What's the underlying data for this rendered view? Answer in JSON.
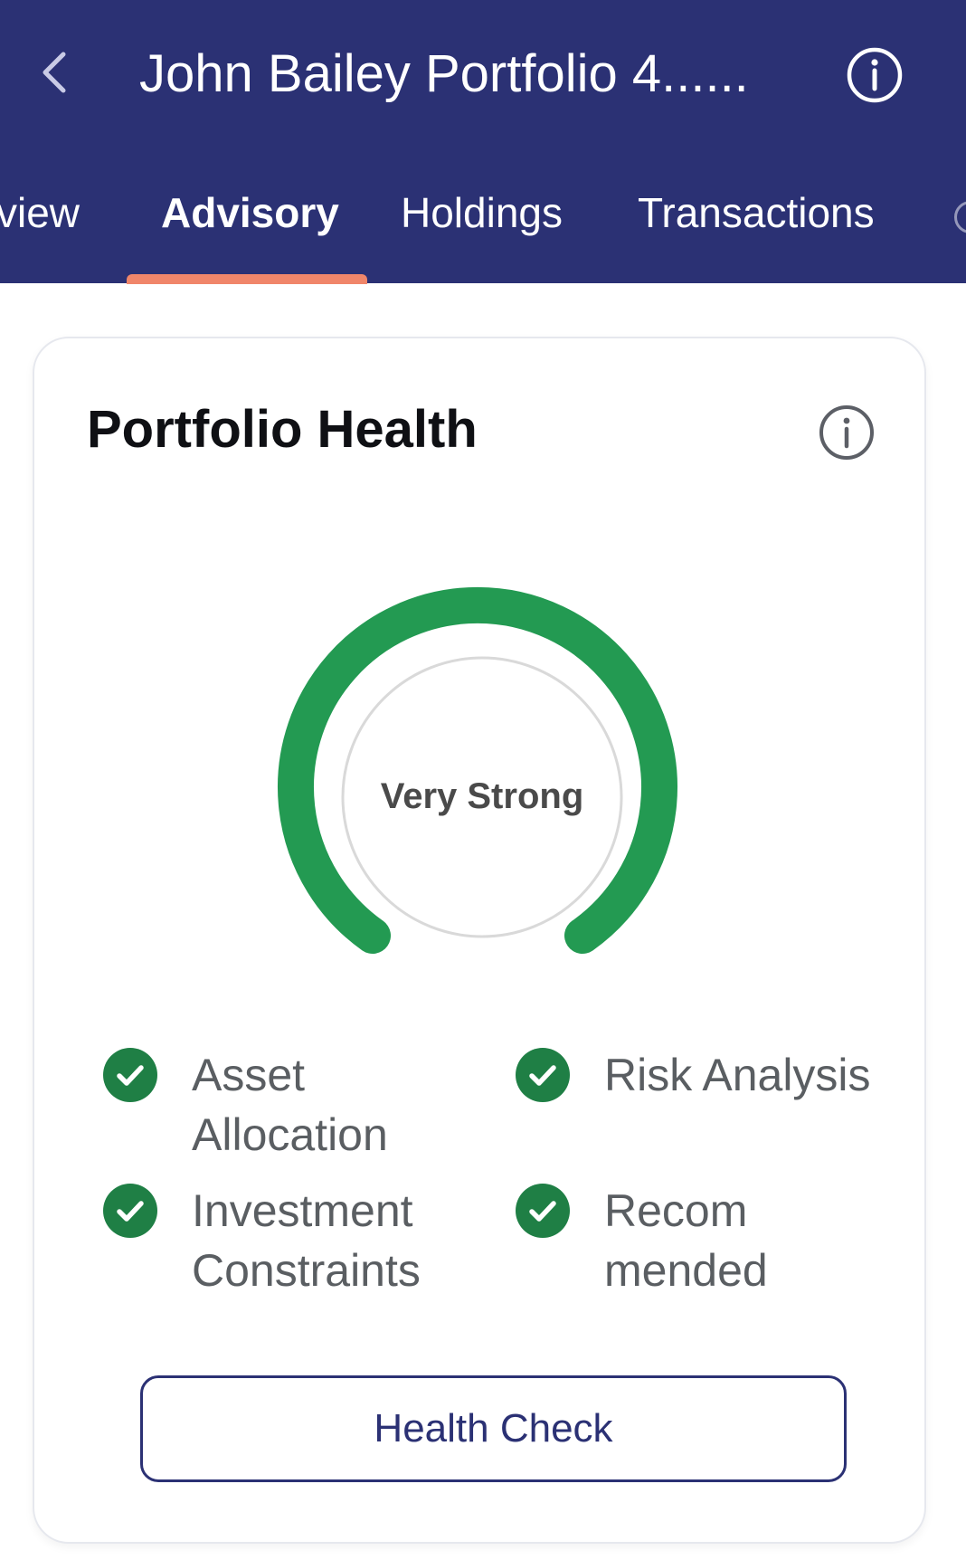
{
  "header": {
    "title": "John Bailey Portfolio 4......",
    "back_icon": "chevron-left-icon",
    "info_icon": "info-icon",
    "background": "#2b3174"
  },
  "tabs": [
    {
      "label": "view",
      "active": false
    },
    {
      "label": "Advisory",
      "active": true
    },
    {
      "label": "Holdings",
      "active": false
    },
    {
      "label": "Transactions",
      "active": false
    }
  ],
  "accent": "#f0866a",
  "card": {
    "title": "Portfolio Health",
    "info_icon": "info-icon",
    "gauge": {
      "label": "Very Strong",
      "color": "#239a52"
    },
    "checks": [
      {
        "label": "Asset Allocation",
        "status": "check",
        "color": "#1f7f45"
      },
      {
        "label": "Risk Analysis",
        "status": "check",
        "color": "#1f7f45"
      },
      {
        "label": "Investment Constraints",
        "status": "check",
        "color": "#1f7f45"
      },
      {
        "label": "Recom mended",
        "status": "check",
        "color": "#1f7f45"
      }
    ],
    "button_label": "Health Check"
  }
}
